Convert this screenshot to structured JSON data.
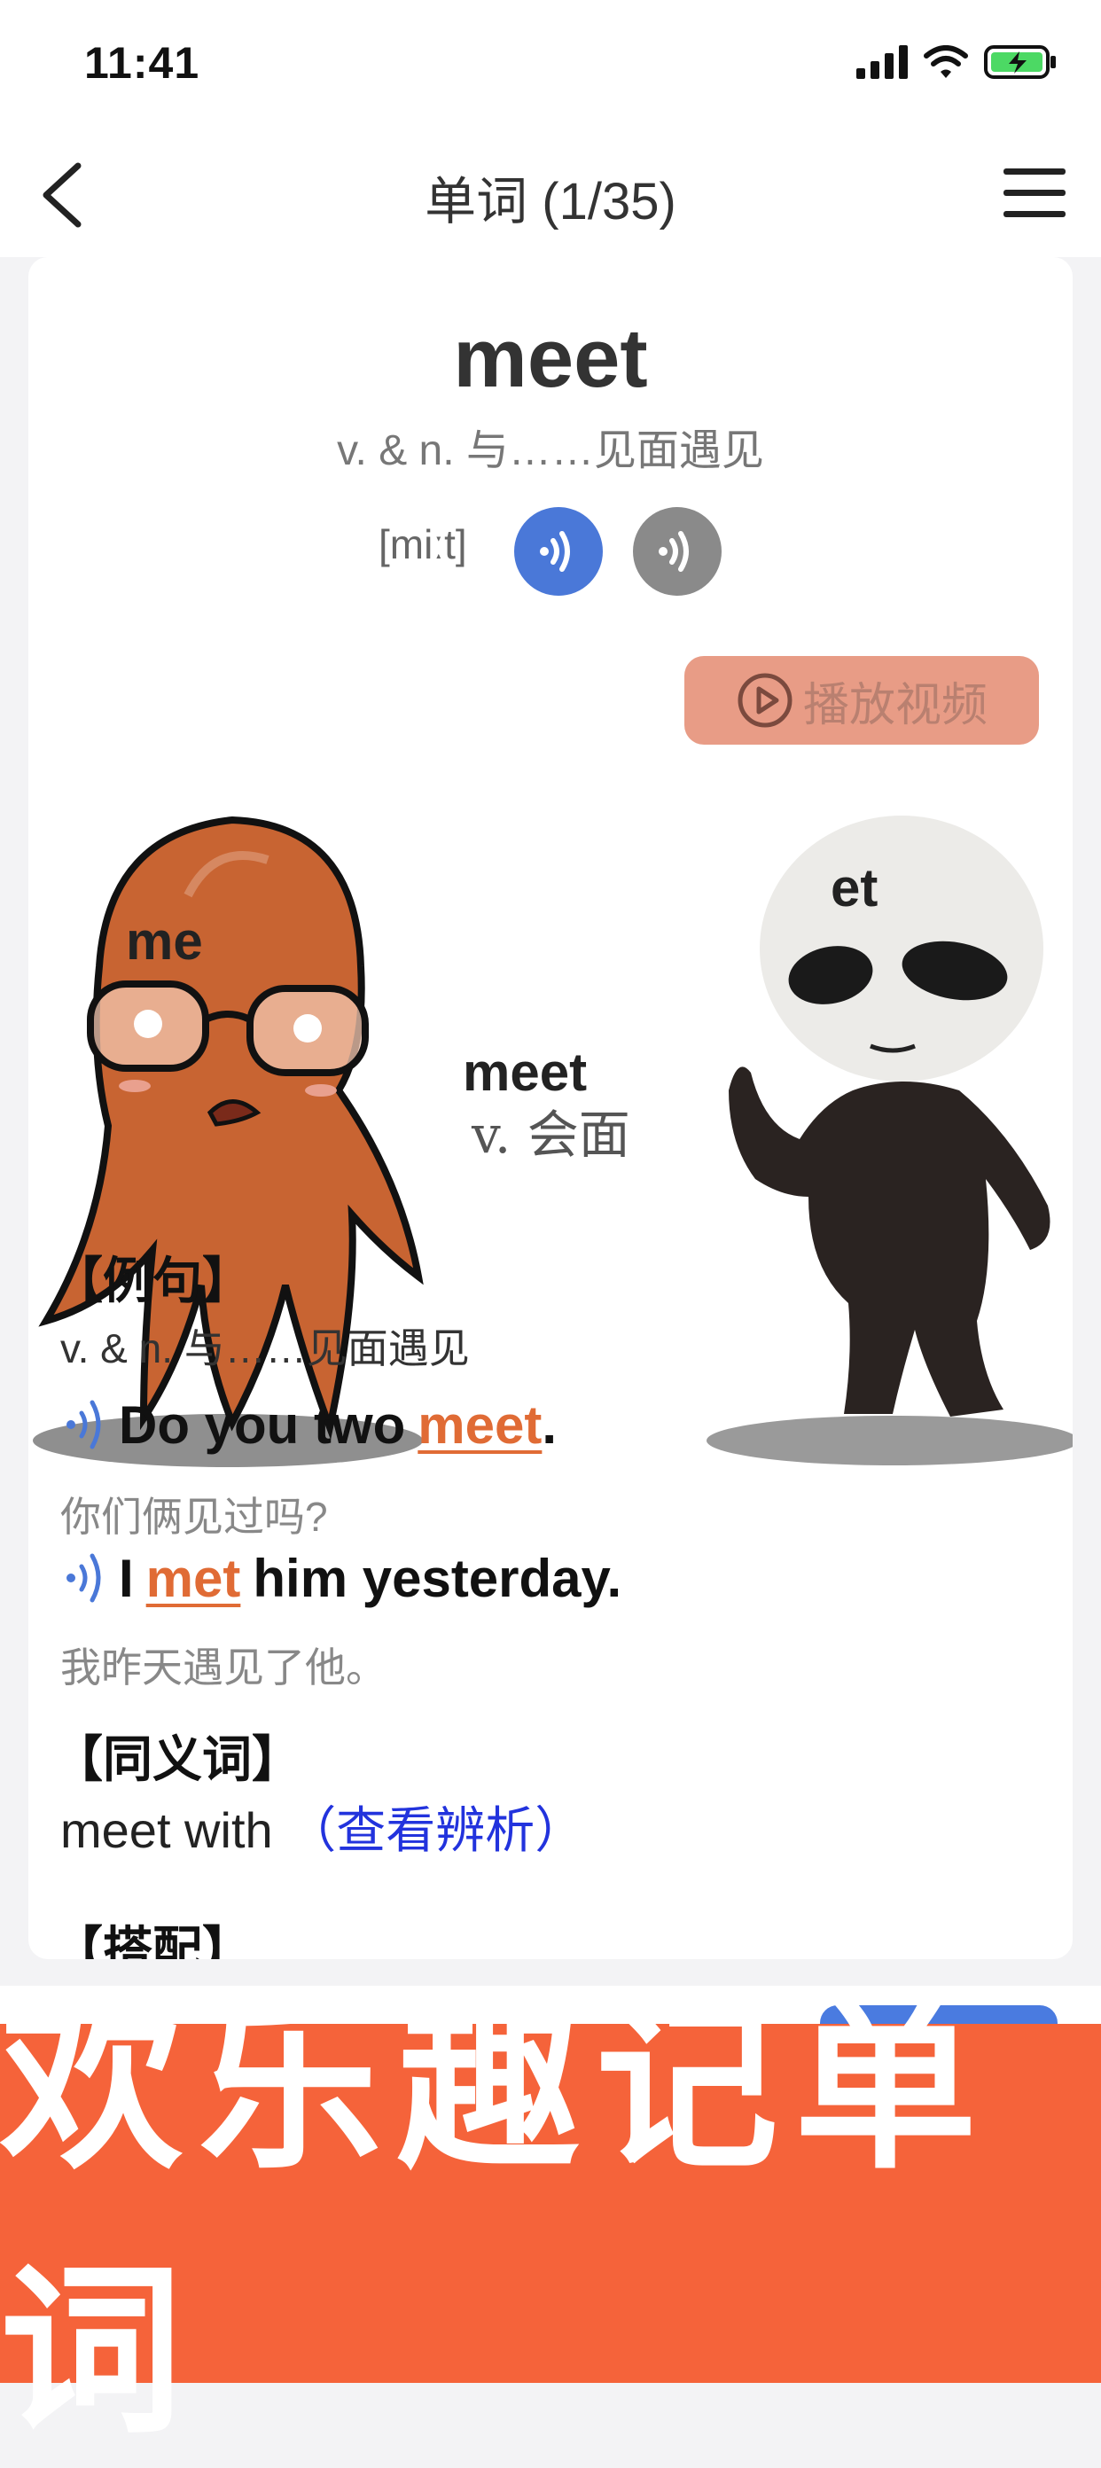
{
  "status_bar": {
    "time": "11:41"
  },
  "nav": {
    "title": "单词 (1/35)"
  },
  "word": {
    "headword": "meet",
    "definition": "v. & n. 与……见面遇见",
    "phonetic": "[miːt]"
  },
  "illustration": {
    "label_left": "me",
    "label_center": "meet",
    "label_center_sub": "v. 会面",
    "label_right": "et"
  },
  "play_video_label": "播放视频",
  "examples": {
    "heading": "【例句】",
    "definition": "v. & n. 与……见面遇见",
    "items": [
      {
        "before": "Do you two",
        "highlight": "meet",
        "after": ".",
        "translation": "你们俩见过吗?"
      },
      {
        "before": "I",
        "highlight": "met",
        "after": "him yesterday.",
        "translation": "我昨天遇见了他。"
      }
    ]
  },
  "synonyms": {
    "heading": "【同义词】",
    "word": "meet with",
    "link": "（查看辨析）"
  },
  "collocation": {
    "heading": "【搭配】"
  },
  "banner": {
    "text": "欢乐趣记单词"
  },
  "colors": {
    "accent_blue": "#4a78d8",
    "highlight_orange": "#e06b35",
    "banner": "#f5633a",
    "link_blue": "#2233dd"
  }
}
